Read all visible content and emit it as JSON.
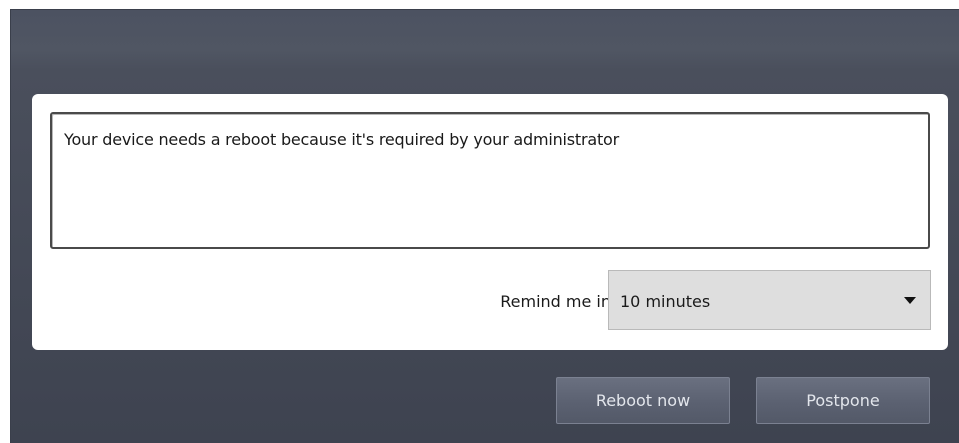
{
  "message": "Your device needs a reboot because it's required by your administrator",
  "remind": {
    "label": "Remind me in",
    "selected": "10 minutes"
  },
  "buttons": {
    "reboot_now": "Reboot now",
    "postpone": "Postpone"
  }
}
